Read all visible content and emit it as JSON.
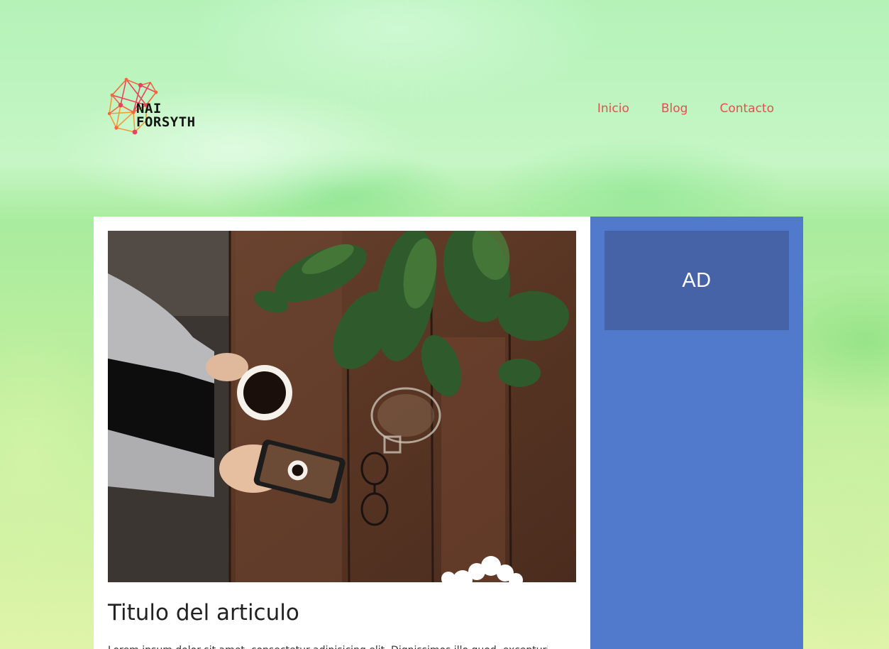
{
  "site": {
    "logo_line1": "NAI",
    "logo_line2": "FORSYTH",
    "accent_color": "#e0524f",
    "logo_network_colors": [
      "#f26a3d",
      "#e9435f",
      "#f39a3a"
    ]
  },
  "nav": {
    "items": [
      {
        "label": "Inicio"
      },
      {
        "label": "Blog"
      },
      {
        "label": "Contacto"
      }
    ]
  },
  "article": {
    "image_icon": "coffee-table-photo",
    "title": "Titulo del articulo",
    "excerpt": "Lorem ipsum dolor sit amet, consectetur adipisicing elit. Dignissimos illo quod, excepturi ut"
  },
  "sidebar": {
    "ad_label": "AD",
    "background": "#527acc",
    "ad_background": "#4563a6"
  }
}
